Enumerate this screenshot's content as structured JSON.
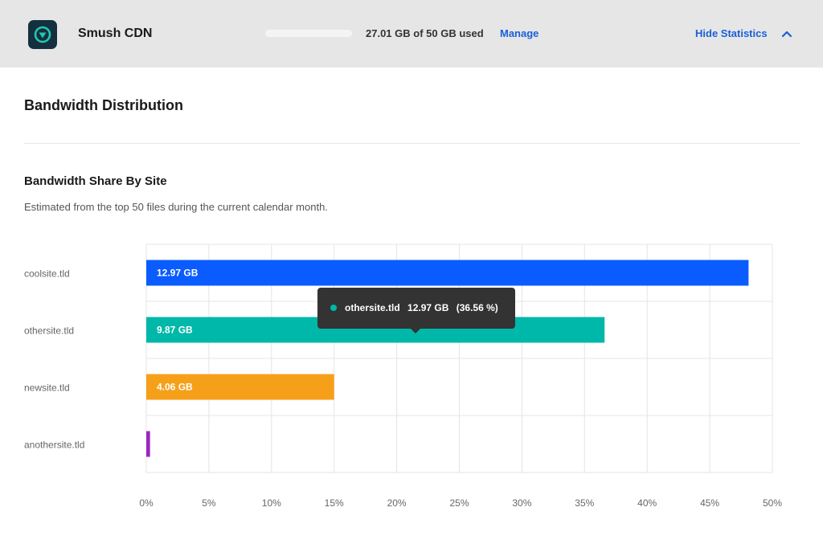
{
  "header": {
    "app_title": "Smush CDN",
    "usage_text": "27.01 GB of 50 GB used",
    "manage_label": "Manage",
    "hide_stats_label": "Hide Statistics",
    "logo_icon": "smush-logo-icon",
    "chevron_icon": "chevron-up-icon"
  },
  "section": {
    "title": "Bandwidth Distribution"
  },
  "chart_data": {
    "type": "bar",
    "orientation": "horizontal",
    "title": "Bandwidth Share By Site",
    "subtitle": "Estimated from the top 50 files during the current calendar month.",
    "categories": [
      "coolsite.tld",
      "othersite.tld",
      "newsite.tld",
      "anothersite.tld"
    ],
    "values": [
      48.1,
      36.6,
      15.0,
      0.3
    ],
    "labels": [
      "12.97 GB",
      "9.87 GB",
      "4.06 GB",
      ""
    ],
    "colors": [
      "#0a5cff",
      "#00b8a9",
      "#f6a01a",
      "#9b27c1"
    ],
    "xlim": [
      0,
      50
    ],
    "xticks": [
      "0%",
      "5%",
      "10%",
      "15%",
      "20%",
      "25%",
      "30%",
      "35%",
      "40%",
      "45%",
      "50%"
    ],
    "grid": true,
    "tooltip": {
      "site": "othersite.tld",
      "size": "12.97 GB",
      "percent": "(36.56 %)"
    }
  }
}
